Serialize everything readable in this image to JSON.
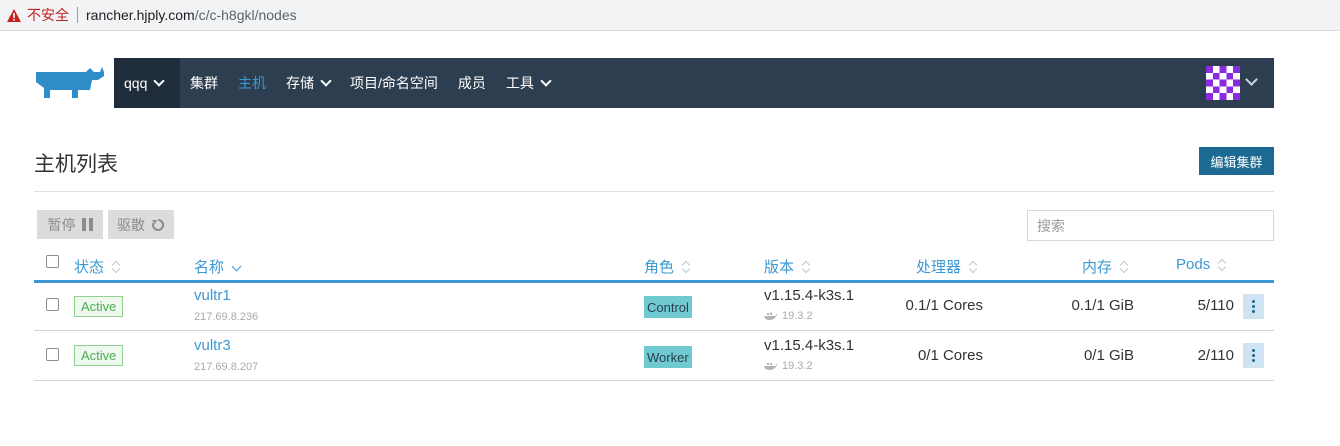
{
  "browser": {
    "insecure_label": "不安全",
    "url_host": "rancher.hjply.com",
    "url_path": "/c/c-h8gkl/nodes"
  },
  "nav": {
    "cluster": "qqq",
    "items": [
      {
        "label": "集群",
        "active": false,
        "dropdown": false
      },
      {
        "label": "主机",
        "active": true,
        "dropdown": false
      },
      {
        "label": "存储",
        "active": false,
        "dropdown": true
      },
      {
        "label": "项目/命名空间",
        "active": false,
        "dropdown": false
      },
      {
        "label": "成员",
        "active": false,
        "dropdown": false
      },
      {
        "label": "工具",
        "active": false,
        "dropdown": true
      }
    ]
  },
  "page": {
    "title": "主机列表",
    "edit_button": "编辑集群",
    "pause_button": "暂停",
    "drain_button": "驱散",
    "search_placeholder": "搜索"
  },
  "table": {
    "headers": {
      "state": "状态",
      "name": "名称",
      "role": "角色",
      "version": "版本",
      "cpu": "处理器",
      "memory": "内存",
      "pods": "Pods"
    },
    "rows": [
      {
        "state": "Active",
        "name": "vultr1",
        "ip": "217.69.8.236",
        "role": "Control",
        "version": "v1.15.4-k3s.1",
        "docker": "19.3.2",
        "cpu": "0.1/1 Cores",
        "memory": "0.1/1 GiB",
        "pods": "5/110"
      },
      {
        "state": "Active",
        "name": "vultr3",
        "ip": "217.69.8.207",
        "role": "Worker",
        "version": "v1.15.4-k3s.1",
        "docker": "19.3.2",
        "cpu": "0/1 Cores",
        "memory": "0/1 GiB",
        "pods": "2/110"
      }
    ]
  },
  "colors": {
    "nav_bg": "#2d3e50",
    "accent": "#3d98d3",
    "primary_button": "#1c6a93",
    "role_badge": "#6ecad0",
    "active_badge": "#4caf50"
  }
}
